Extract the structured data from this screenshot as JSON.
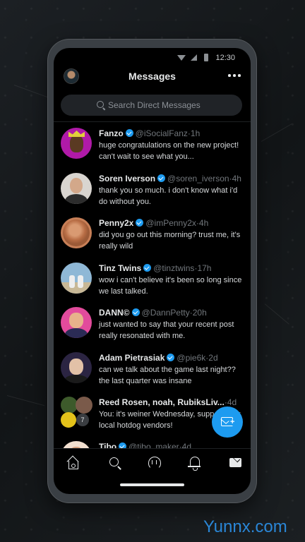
{
  "status_bar": {
    "time": "12:30"
  },
  "header": {
    "title": "Messages"
  },
  "search": {
    "placeholder": "Search Direct Messages"
  },
  "conversations": [
    {
      "name": "Fanzo",
      "verified": true,
      "handle": "@iSocialFanz",
      "time": "1h",
      "preview": "huge congratulations on the new project! can't wait to see what you..."
    },
    {
      "name": "Soren Iverson",
      "verified": true,
      "handle": "@soren_iverson",
      "time": "4h",
      "preview": "thank you so much. i don't know what i'd do without you."
    },
    {
      "name": "Penny2x",
      "verified": true,
      "handle": "@imPenny2x",
      "time": "4h",
      "preview": "did you go out this morning? trust me, it's really wild"
    },
    {
      "name": "Tinz Twins",
      "verified": true,
      "handle": "@tinztwins",
      "time": "17h",
      "preview": "wow i can't believe it's been so long since we last talked."
    },
    {
      "name": "DANN©",
      "verified": true,
      "handle": "@DannPetty",
      "time": "20h",
      "preview": "just wanted to say that your recent post really resonated with me."
    },
    {
      "name": "Adam Pietrasiak",
      "verified": true,
      "handle": "@pie6k",
      "time": "2d",
      "preview": "can we talk about the game last night?? the last quarter was insane"
    },
    {
      "name": "Reed Rosen, noah, RubiksLiv...",
      "verified": false,
      "handle": "",
      "time": "4d",
      "preview": "You: it's weiner Wednesday, support your local hotdog vendors!",
      "member_count": "7"
    },
    {
      "name": "Tibo",
      "verified": true,
      "handle": "@tibo_maker",
      "time": "4d",
      "preview": ""
    }
  ],
  "watermark": "Yunnx.com",
  "colors": {
    "accent": "#1d9bf0",
    "background": "#000000",
    "muted_text": "#71767b"
  },
  "icons": [
    "wifi-icon",
    "signal-icon",
    "battery-icon",
    "more-icon",
    "search-icon",
    "verified-icon",
    "compose-dm-icon",
    "home-icon",
    "search-nav-icon",
    "spaces-icon",
    "bell-icon",
    "messages-icon"
  ]
}
